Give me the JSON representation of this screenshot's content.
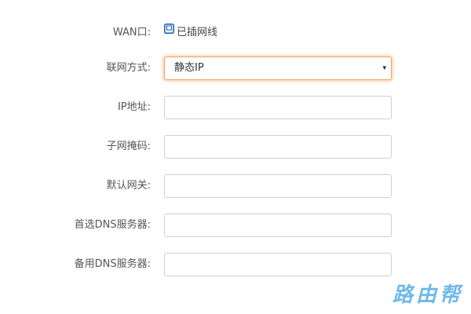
{
  "form": {
    "wan": {
      "label": "WAN口:",
      "status_text": "已插网线",
      "icon": "ethernet-port-icon"
    },
    "connection_type": {
      "label": "联网方式:",
      "selected": "静态IP",
      "caret": "▾"
    },
    "ip_address": {
      "label": "IP地址:",
      "value": ""
    },
    "subnet_mask": {
      "label": "子网掩码:",
      "value": ""
    },
    "gateway": {
      "label": "默认网关:",
      "value": ""
    },
    "primary_dns": {
      "label": "首选DNS服务器:",
      "value": ""
    },
    "secondary_dns": {
      "label": "备用DNS服务器:",
      "value": ""
    }
  },
  "watermark": {
    "text": "路由帮"
  },
  "colors": {
    "focus_border": "#f5a360",
    "icon_blue": "#1a5fb4",
    "watermark": "#6fb8ea"
  }
}
